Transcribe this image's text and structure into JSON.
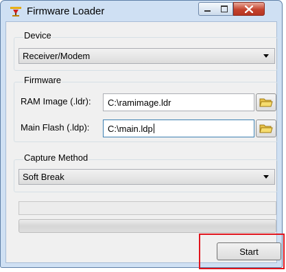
{
  "window": {
    "title": "Firmware Loader"
  },
  "device": {
    "group_label": "Device",
    "selected": "Receiver/Modem"
  },
  "firmware": {
    "group_label": "Firmware",
    "ram_label": "RAM Image (.ldr):",
    "ram_value": "C:\\ramimage.ldr",
    "flash_label": "Main Flash (.ldp):",
    "flash_value": "C:\\main.ldp"
  },
  "capture": {
    "group_label": "Capture Method",
    "selected": "Soft Break"
  },
  "progress": {
    "value": 0
  },
  "actions": {
    "start_label": "Start"
  },
  "colors": {
    "highlight": "#e0141c",
    "title_bar": "#cfe0f3",
    "close_button": "#c5432e"
  }
}
